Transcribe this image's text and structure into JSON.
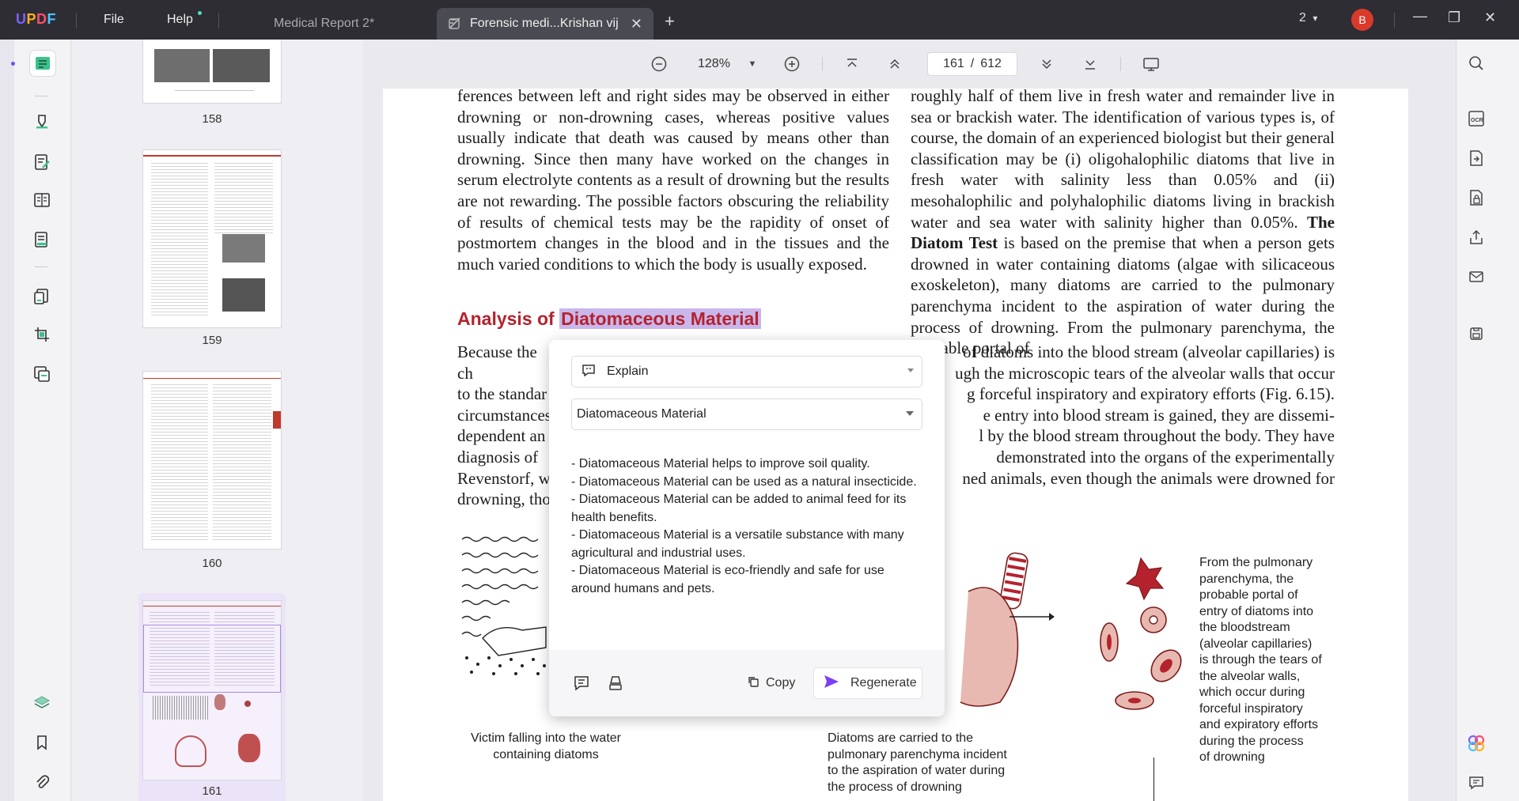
{
  "titlebar": {
    "logo": "UPDF",
    "menu": {
      "file": "File",
      "help": "Help"
    },
    "tabs": [
      {
        "label": "Medical Report 2*"
      },
      {
        "label": "Forensic medi...Krishan vij"
      }
    ],
    "window_count": "2",
    "avatar_initial": "B"
  },
  "thumbnails": [
    {
      "page": "158"
    },
    {
      "page": "159"
    },
    {
      "page": "160"
    },
    {
      "page": "161"
    }
  ],
  "toolbar": {
    "zoom": "128%",
    "current_page": "161",
    "page_sep": "/",
    "total_pages": "612"
  },
  "document": {
    "left_column": "ferences between left and right sides may be observed in either drowning or non-drowning cases, whereas positive values usually indicate that death was caused by means other than drowning. Since then many have worked on the changes in serum electrolyte contents as a result of drowning but the results are not rewarding. The possible factors obscuring the reliability of results of chemical tests may be the rapidity of onset of postmortem changes in the blood and in the tissues and the much varied conditions to which the body is usually exposed.",
    "heading_prefix": "Analysis of ",
    "heading_highlight": "Diatomaceous Material",
    "left_column_2": [
      "Because the ch",
      "to the standar",
      "circumstances",
      "dependent an",
      "diagnosis of",
      "Revenstorf, w",
      "drowning, tho"
    ],
    "right_column_1": "roughly half of them live in fresh water and remainder live in sea or brackish water. The identification of various types is, of course, the domain of an experienced biologist but their general classification may be (i) oligohalophilic diatoms that live in fresh water with salinity less than 0.05% and (ii) mesohalophilic and polyhalophilic diatoms living in brackish water and sea water with salinity higher than 0.05%. ",
    "right_bold": "The Diatom Test",
    "right_column_2": " is based on the premise that when a person gets drowned in water containing diatoms (algae with silicaceous exoskeleton), many diatoms are carried to the pulmonary parenchyma incident to the aspiration of water during the process of drowning. From the pulmonary parenchyma, the probable portal of",
    "right_column_3": [
      "of diatoms into the blood stream (alveolar capillaries) is",
      "ugh the microscopic tears of the alveolar walls that occur",
      "g forceful inspiratory and expiratory efforts (Fig. 6.15).",
      "e entry into blood stream is gained, they are dissemi-",
      "l by the blood stream throughout the body. They have",
      "demonstrated into the organs of the experimentally",
      "ned animals, even though the animals were drowned for"
    ],
    "caption_1": [
      "Victim falling into the water",
      "containing diatoms"
    ],
    "caption_2": [
      "Diatoms are carried to the",
      "pulmonary parenchyma incident",
      "to the aspiration of water during",
      "the process of drowning"
    ],
    "caption_3": [
      "From the pulmonary",
      "parenchyma, the",
      "probable portal of",
      "entry of diatoms into",
      "the bloodstream",
      "(alveolar capillaries)",
      "is through the tears of",
      "the alveolar walls,",
      "which occur during",
      "forceful inspiratory",
      "and expiratory efforts",
      "during the process",
      "of drowning"
    ]
  },
  "ai_popup": {
    "mode": "Explain",
    "prompt": "Diatomaceous Material",
    "result_lines": [
      "- Diatomaceous Material helps to improve soil quality.",
      "- Diatomaceous Material can be used as a natural insecticide.",
      "- Diatomaceous Material can be added to animal feed for its health benefits.",
      "- Diatomaceous Material is a versatile substance with many agricultural and industrial uses.",
      "- Diatomaceous Material is eco-friendly and safe for use around humans and pets."
    ],
    "copy_label": "Copy",
    "regenerate_label": "Regenerate"
  },
  "colors": {
    "titlebar": "#2d2d33",
    "heading": "#b4232d",
    "highlight": "#c9b7ec",
    "accent": "#7b3ff2"
  }
}
